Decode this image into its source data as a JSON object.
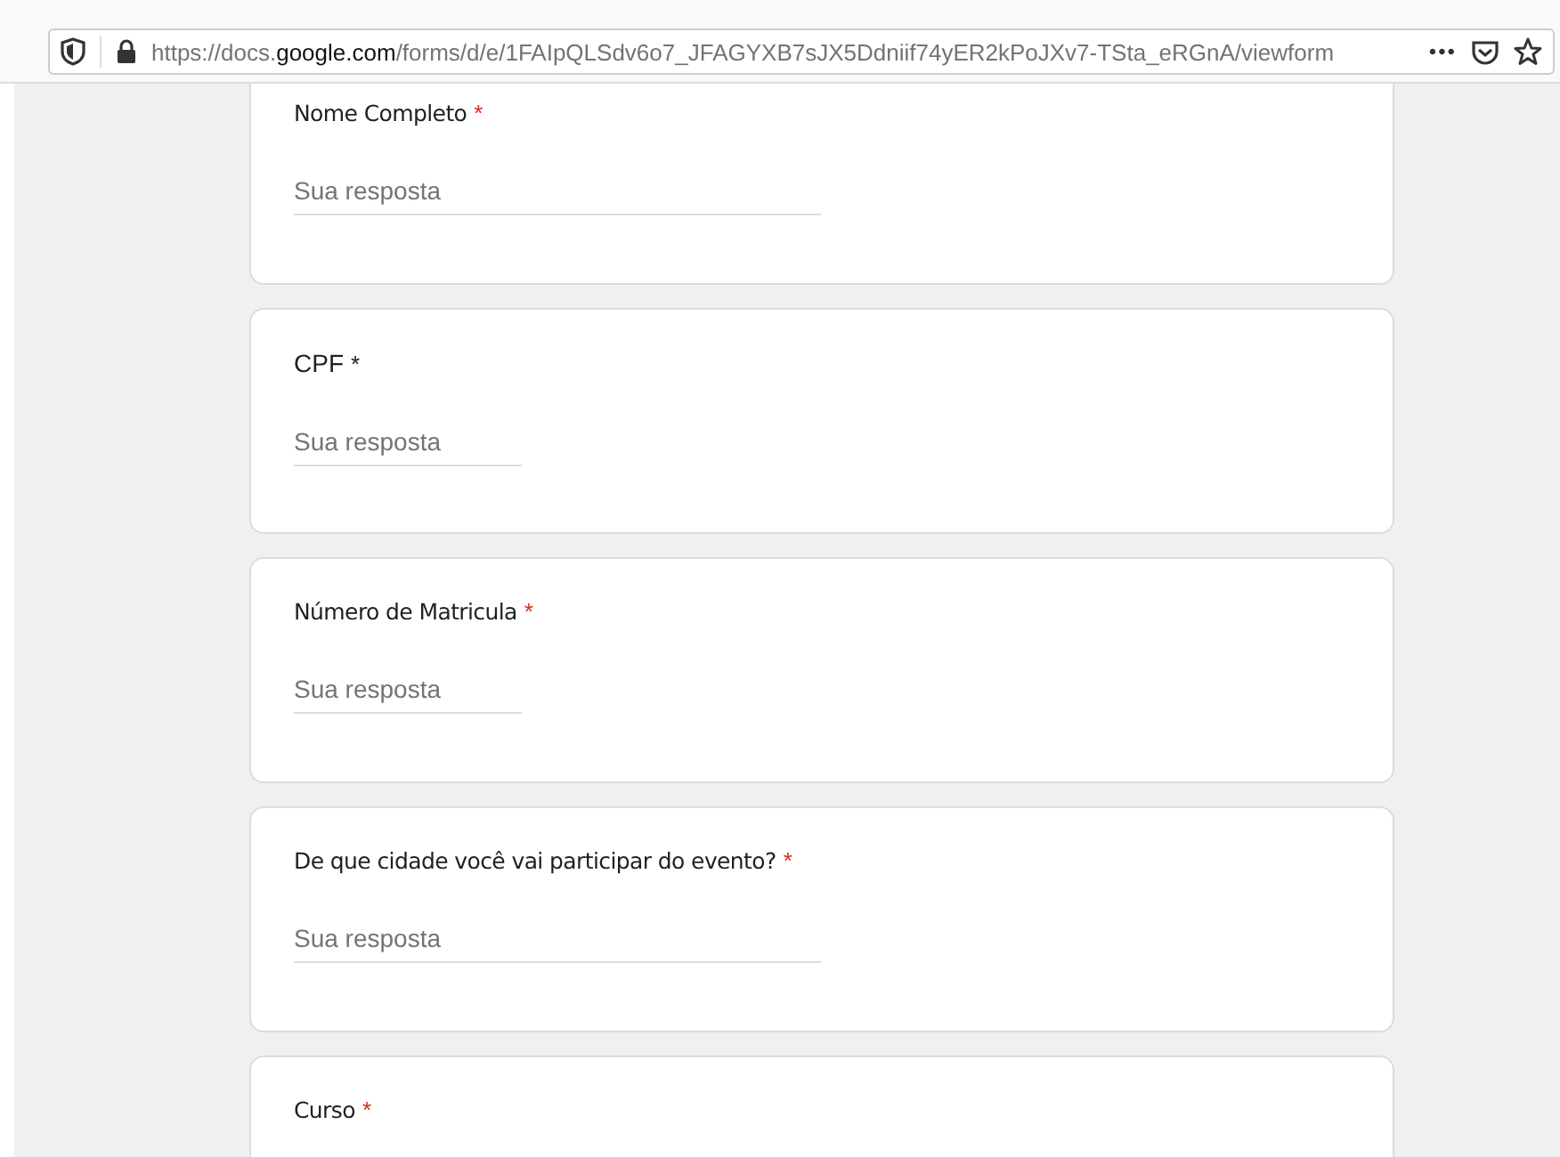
{
  "address_bar": {
    "url": "https://docs.**google.com**/forms/d/e/1FAIpQLSdv6o7_JFAGYXB7sJX5Ddniif74yER2kPoJXv7-TSta_eRGnA/viewform",
    "menu": "•••"
  },
  "questions": [
    {
      "label": "Nome Completo",
      "required": "*",
      "color": "#d93025",
      "handwritten": true,
      "placeholder": "Sua resposta",
      "kind": "wide"
    },
    {
      "label": "CPF",
      "required": "*",
      "color": "#202124",
      "handwritten": false,
      "placeholder": "Sua resposta",
      "kind": "short"
    },
    {
      "label": "Número de Matricula",
      "required": "*",
      "color": "#d93025",
      "handwritten": true,
      "placeholder": "Sua resposta",
      "kind": "short"
    },
    {
      "label": "De que cidade você vai participar do evento?",
      "required": "*",
      "color": "#d93025",
      "handwritten": true,
      "placeholder": "Sua resposta",
      "kind": "wide"
    },
    {
      "label": "Curso",
      "required": "*",
      "color": "#d93025",
      "handwritten": true,
      "kind": "none"
    }
  ]
}
